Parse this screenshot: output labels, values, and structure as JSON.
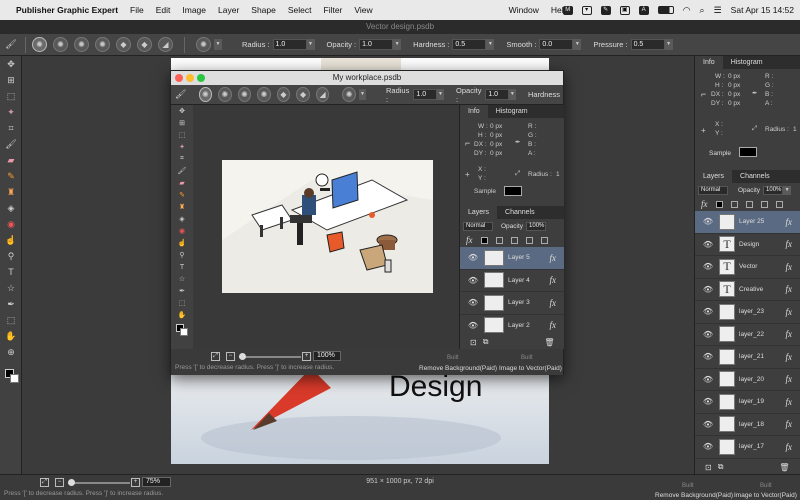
{
  "menubar": {
    "app_name": "Publisher Graphic Expert",
    "items": [
      "File",
      "Edit",
      "Image",
      "Layer",
      "Shape",
      "Select",
      "Filter",
      "View"
    ],
    "right_items": [
      "Window",
      "Help"
    ],
    "status_icons": [
      "M",
      "A"
    ],
    "clock": "Sat Apr 15  14:52"
  },
  "document": {
    "title": "Vector design.psdb",
    "canvas_text": "Design",
    "size_info": "951 × 1000 px, 72 dpi",
    "zoom": "75%"
  },
  "options_bar": {
    "radius_label": "Radius :",
    "radius_value": "1.0",
    "opacity_label": "Opacity :",
    "opacity_value": "1.0",
    "hardness_label": "Hardness :",
    "hardness_value": "0.5",
    "smooth_label": "Smooth :",
    "smooth_value": "0.0",
    "pressure_label": "Pressure :",
    "pressure_value": "0.5"
  },
  "hint": "Press '[' to decrease radius. Press ']' to increase radius.",
  "built_label": "Built",
  "bottom_actions": {
    "remove_bg": "Remove Background(Paid)",
    "image_to_vector": "Image to Vector(Paid)"
  },
  "info_panel": {
    "tabs": [
      "Info",
      "Histogram"
    ],
    "w": "W :",
    "w_val": "0 px",
    "h": "H :",
    "h_val": "0 px",
    "dx": "DX :",
    "dx_val": "0 px",
    "dy": "DY :",
    "dy_val": "0 px",
    "r": "R :",
    "g": "G :",
    "b": "B :",
    "a": "A :",
    "x": "X :",
    "y": "Y :",
    "radius": "Radius :",
    "radius_val": "1",
    "sample": "Sample"
  },
  "layers_panel": {
    "tabs": [
      "Layers",
      "Channels"
    ],
    "blend_mode": "Normal",
    "opacity_label": "Opacity",
    "opacity_value": "100%",
    "fx_label": "fx",
    "layers": [
      {
        "name": "Layer 25",
        "thumb": "",
        "selected": true
      },
      {
        "name": "Design",
        "thumb": "T",
        "selected": false
      },
      {
        "name": "Vector",
        "thumb": "T",
        "selected": false
      },
      {
        "name": "Creative",
        "thumb": "T",
        "selected": false
      },
      {
        "name": "layer_23",
        "thumb": "",
        "selected": false
      },
      {
        "name": "layer_22",
        "thumb": "",
        "selected": false
      },
      {
        "name": "layer_21",
        "thumb": "",
        "selected": false
      },
      {
        "name": "layer_20",
        "thumb": "",
        "selected": false
      },
      {
        "name": "layer_19",
        "thumb": "",
        "selected": false
      },
      {
        "name": "layer_18",
        "thumb": "",
        "selected": false
      },
      {
        "name": "layer_17",
        "thumb": "",
        "selected": false
      }
    ]
  },
  "workplace_window": {
    "title": "My workplace.psdb",
    "radius_label": "Radius :",
    "radius_value": "1.0",
    "opacity_label": "Opacity :",
    "opacity_value": "1.0",
    "hardness_label": "Hardness",
    "zoom": "100%",
    "layers": [
      {
        "name": "Layer 5",
        "selected": true
      },
      {
        "name": "Layer 4",
        "selected": false
      },
      {
        "name": "Layer 3",
        "selected": false
      },
      {
        "name": "Layer 2",
        "selected": false
      }
    ]
  }
}
